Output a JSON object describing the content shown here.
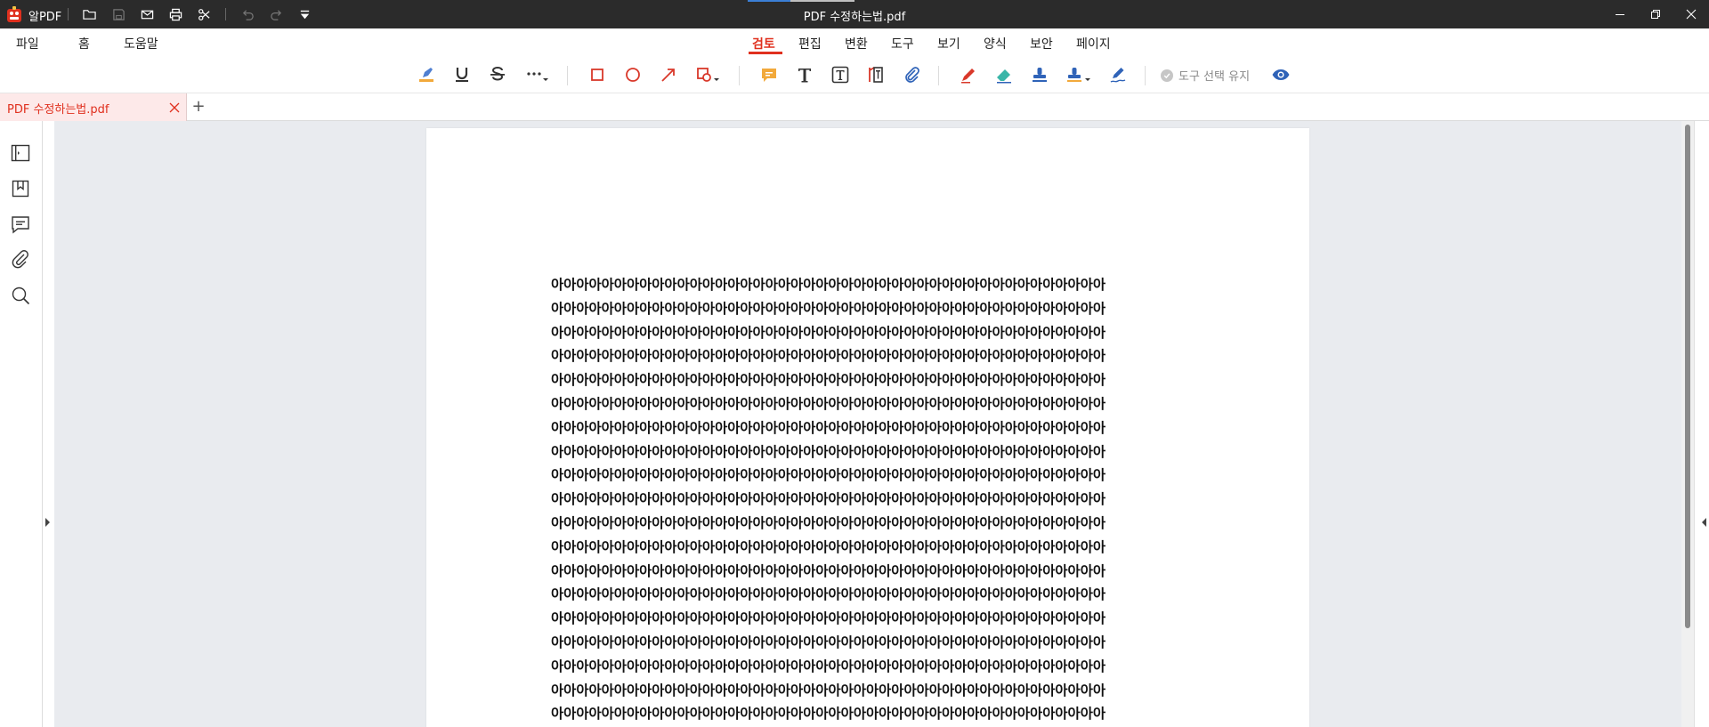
{
  "app": {
    "name": "알PDF",
    "title": "PDF 수정하는법.pdf"
  },
  "menu": {
    "file": "파일",
    "home": "홈",
    "help": "도움말"
  },
  "tabs": [
    {
      "label": "검토",
      "active": true
    },
    {
      "label": "편집"
    },
    {
      "label": "변환"
    },
    {
      "label": "도구"
    },
    {
      "label": "보기"
    },
    {
      "label": "양식"
    },
    {
      "label": "보안"
    },
    {
      "label": "페이지"
    }
  ],
  "toolbar": {
    "keep_tool_label": "도구 선택 유지"
  },
  "document_tab": {
    "label": "PDF 수정하는법.pdf",
    "new_tab": "+"
  },
  "colors": {
    "accent": "#e0301e",
    "titlebar": "#2b2b2b",
    "workspace": "#e9ebef",
    "highlight": "#f2a93b",
    "annot_blue": "#2f63b8"
  },
  "document": {
    "lines": [
      "아아아아아아아아아아아아아아아아아아아아아아아아아아아아아아아아아아아아아아아아아아아아",
      "아아아아아아아아아아아아아아아아아아아아아아아아아아아아아아아아아아아아아아아아아아아아",
      "아아아아아아아아아아아아아아아아아아아아아아아아아아아아아아아아아아아아아아아아아아아아",
      "아아아아아아아아아아아아아아아아아아아아아아아아아아아아아아아아아아아아아아아아아아아아",
      "아아아아아아아아아아아아아아아아아아아아아아아아아아아아아아아아아아아아아아아아아아아아",
      "아아아아아아아아아아아아아아아아아아아아아아아아아아아아아아아아아아아아아아아아아아아아",
      "아아아아아아아아아아아아아아아아아아아아아아아아아아아아아아아아아아아아아아아아아아아아",
      "아아아아아아아아아아아아아아아아아아아아아아아아아아아아아아아아아아아아아아아아아아아아",
      "아아아아아아아아아아아아아아아아아아아아아아아아아아아아아아아아아아아아아아아아아아아아",
      "아아아아아아아아아아아아아아아아아아아아아아아아아아아아아아아아아아아아아아아아아아아아",
      "아아아아아아아아아아아아아아아아아아아아아아아아아아아아아아아아아아아아아아아아아아아아",
      "아아아아아아아아아아아아아아아아아아아아아아아아아아아아아아아아아아아아아아아아아아아아",
      "아아아아아아아아아아아아아아아아아아아아아아아아아아아아아아아아아아아아아아아아아아아아",
      "아아아아아아아아아아아아아아아아아아아아아아아아아아아아아아아아아아아아아아아아아아아아",
      "아아아아아아아아아아아아아아아아아아아아아아아아아아아아아아아아아아아아아아아아아아아아",
      "아아아아아아아아아아아아아아아아아아아아아아아아아아아아아아아아아아아아아아아아아아아아",
      "아아아아아아아아아아아아아아아아아아아아아아아아아아아아아아아아아아아아아아아아아아아아",
      "아아아아아아아아아아아아아아아아아아아아아아아아아아아아아아아아아아아아아아아아아아아아",
      "아아아아아아아아아아아아아아아아아아아아아아아아아아아아아아아아아아아아아아아아아아아아"
    ]
  }
}
